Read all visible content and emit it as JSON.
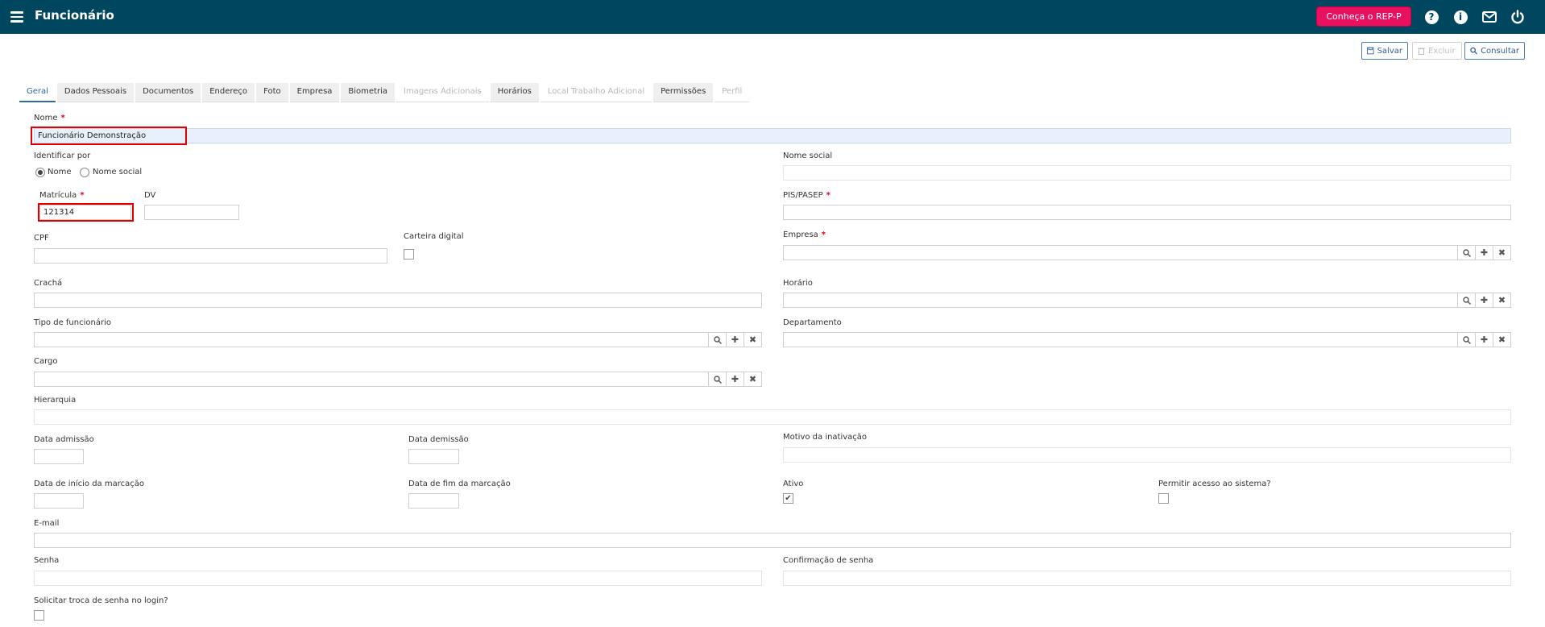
{
  "header": {
    "title": "Funcionário",
    "rep_button": "Conheça o REP-P",
    "icons": [
      "menu-icon",
      "help-icon",
      "info-icon",
      "mail-icon",
      "power-icon"
    ]
  },
  "actions": {
    "save": "Salvar",
    "delete": "Excluir",
    "search": "Consultar"
  },
  "tabs": [
    "Geral",
    "Dados Pessoais",
    "Documentos",
    "Endereço",
    "Foto",
    "Empresa",
    "Biometria",
    "Imagens Adicionais",
    "Horários",
    "Local Trabalho Adicional",
    "Permissões",
    "Perfil"
  ],
  "form": {
    "nome": {
      "label": "Nome",
      "value": "Funcionário Demonstração"
    },
    "identificar_por": {
      "label": "Identificar por",
      "options": [
        "Nome",
        "Nome social"
      ],
      "selected": "Nome"
    },
    "nome_social": {
      "label": "Nome social",
      "value": ""
    },
    "matricula": {
      "label": "Matrícula",
      "value": "121314"
    },
    "dv": {
      "label": "DV",
      "value": ""
    },
    "pis": {
      "label": "PIS/PASEP",
      "value": ""
    },
    "cpf": {
      "label": "CPF",
      "value": ""
    },
    "carteira": {
      "label": "Carteira digital",
      "checked": false
    },
    "empresa": {
      "label": "Empresa",
      "value": ""
    },
    "cracha": {
      "label": "Crachá",
      "value": ""
    },
    "horario": {
      "label": "Horário",
      "value": ""
    },
    "tipo": {
      "label": "Tipo de funcionário",
      "value": ""
    },
    "departamento": {
      "label": "Departamento",
      "value": ""
    },
    "cargo": {
      "label": "Cargo",
      "value": ""
    },
    "hierarquia": {
      "label": "Hierarquia",
      "value": ""
    },
    "data_admissao": {
      "label": "Data admissão",
      "value": ""
    },
    "data_demissao": {
      "label": "Data demissão",
      "value": ""
    },
    "motivo": {
      "label": "Motivo da inativação",
      "value": ""
    },
    "inicio_marcacao": {
      "label": "Data de início da marcação",
      "value": ""
    },
    "fim_marcacao": {
      "label": "Data de fim da marcação",
      "value": ""
    },
    "ativo": {
      "label": "Ativo",
      "checked": true
    },
    "permitir": {
      "label": "Permitir acesso ao sistema?",
      "checked": false
    },
    "email": {
      "label": "E-mail",
      "value": ""
    },
    "senha": {
      "label": "Senha",
      "value": ""
    },
    "confirmacao": {
      "label": "Confirmação de senha",
      "value": ""
    },
    "solicitar": {
      "label": "Solicitar troca de senha no login?",
      "checked": false
    }
  },
  "colors": {
    "header_bg": "#00465e",
    "accent": "#e8115f",
    "required": "#d9001b",
    "highlight": "#e00000"
  }
}
